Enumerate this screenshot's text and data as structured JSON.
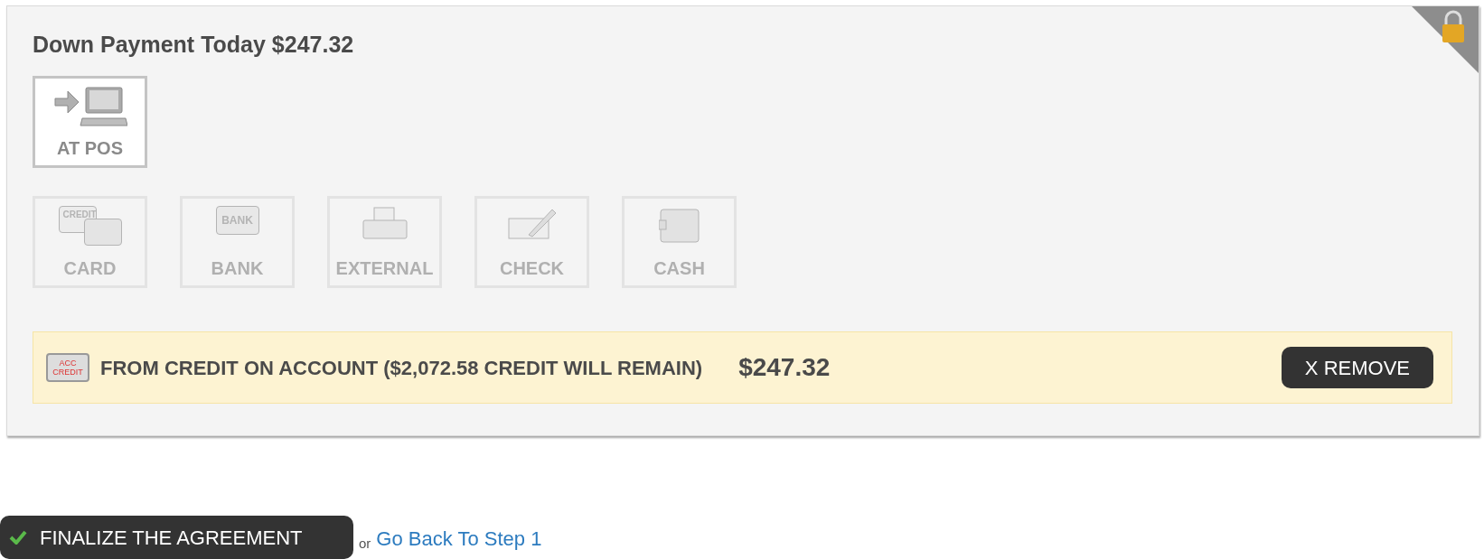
{
  "panel": {
    "title": "Down Payment Today $247.32",
    "locked": true
  },
  "methods": [
    {
      "kind": "pos",
      "label": "AT POS",
      "disabled": false
    },
    {
      "kind": "card",
      "label": "CARD",
      "icon_text": "CREDIT",
      "disabled": true
    },
    {
      "kind": "bank",
      "label": "BANK",
      "icon_text": "BANK",
      "disabled": true
    },
    {
      "kind": "external",
      "label": "EXTERNAL",
      "disabled": true
    },
    {
      "kind": "check",
      "label": "CHECK",
      "disabled": true
    },
    {
      "kind": "cash",
      "label": "CASH",
      "disabled": true
    }
  ],
  "payment": {
    "badge": [
      "ACC",
      "CREDIT"
    ],
    "description": "FROM CREDIT ON ACCOUNT ($2,072.58 CREDIT WILL REMAIN)",
    "amount": "$247.32",
    "remove": "X REMOVE"
  },
  "footer": {
    "finalize": "FINALIZE THE AGREEMENT",
    "or": "or",
    "back": "Go Back To Step 1"
  }
}
